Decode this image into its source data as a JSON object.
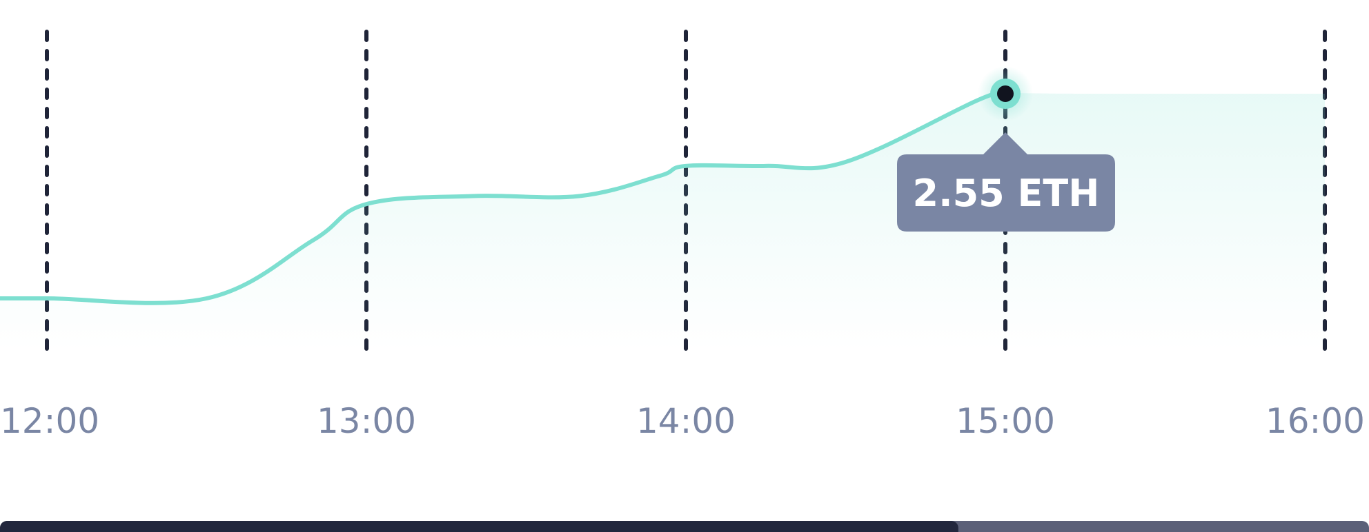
{
  "chart_data": {
    "type": "area",
    "x": [
      "11:47",
      "12:00",
      "12:30",
      "12:50",
      "13:00",
      "13:20",
      "13:40",
      "13:55",
      "14:00",
      "14:15",
      "14:30",
      "14:55",
      "15:00",
      "15:15",
      "16:00"
    ],
    "values": [
      1.53,
      1.53,
      1.53,
      1.82,
      2.0,
      2.04,
      2.04,
      2.14,
      2.19,
      2.19,
      2.21,
      2.52,
      2.55,
      2.55,
      2.55
    ],
    "xticks": [
      "12:00",
      "13:00",
      "14:00",
      "15:00",
      "16:00"
    ],
    "grid": "vertical dashed at each hour",
    "line_color": "#7ddfd0",
    "fill_color": "#e8faf7",
    "grid_color": "#1f2438",
    "tick_color": "#7a86a4",
    "tooltip": {
      "x": "15:00",
      "value": 2.55,
      "label": "2.55 ETH",
      "background": "#7a86a4",
      "text_color": "#ffffff"
    },
    "scrollbar": {
      "position_fraction": 0.7,
      "track_color": "#5b6078",
      "thumb_color": "#22273d"
    }
  }
}
